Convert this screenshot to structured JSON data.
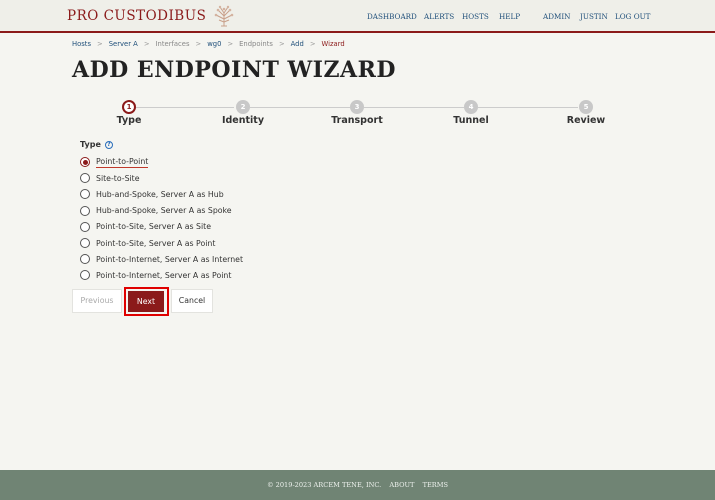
{
  "header": {
    "logo_text": "PRO CUSTODIBUS",
    "logo_icon": "tree-emblem-icon",
    "nav": [
      "DASHBOARD",
      "ALERTS",
      "HOSTS",
      "HELP",
      "ADMIN",
      "JUSTIN",
      "LOG OUT"
    ]
  },
  "breadcrumb": [
    "Hosts",
    "Server A",
    "Interfaces",
    "wg0",
    "Endpoints",
    "Add",
    "Wizard"
  ],
  "breadcrumb_separator": ">",
  "page_title": "ADD ENDPOINT WIZARD",
  "stepper": {
    "steps": [
      {
        "number": "1",
        "label": "Type",
        "active": true
      },
      {
        "number": "2",
        "label": "Identity",
        "active": false
      },
      {
        "number": "3",
        "label": "Transport",
        "active": false
      },
      {
        "number": "4",
        "label": "Tunnel",
        "active": false
      },
      {
        "number": "5",
        "label": "Review",
        "active": false
      }
    ]
  },
  "type_section": {
    "label": "Type",
    "help_icon": "help-icon",
    "help_glyph": "?",
    "options": [
      {
        "label": "Point-to-Point",
        "checked": true
      },
      {
        "label": "Site-to-Site",
        "checked": false
      },
      {
        "label": "Hub-and-Spoke, Server A as Hub",
        "checked": false
      },
      {
        "label": "Hub-and-Spoke, Server A as Spoke",
        "checked": false
      },
      {
        "label": "Point-to-Site, Server A as Site",
        "checked": false
      },
      {
        "label": "Point-to-Site, Server A as Point",
        "checked": false
      },
      {
        "label": "Point-to-Internet, Server A as Internet",
        "checked": false
      },
      {
        "label": "Point-to-Internet, Server A as Point",
        "checked": false
      }
    ]
  },
  "buttons": {
    "previous": "Previous",
    "next": "Next",
    "cancel": "Cancel"
  },
  "footer": {
    "copyright": "© 2019-2023 ARCEM TENE, INC.",
    "about": "ABOUT",
    "terms": "TERMS"
  },
  "colors": {
    "brand": "#8b1a1a",
    "link": "#1f4f7a",
    "footer_bg": "#708474",
    "highlight": "#e00000"
  }
}
